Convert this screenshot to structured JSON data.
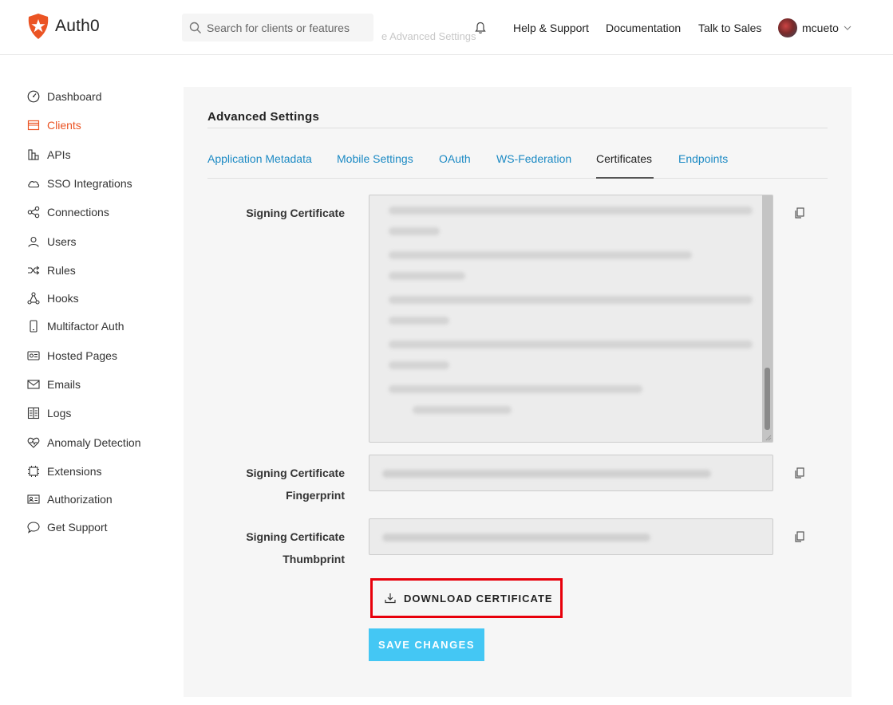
{
  "header": {
    "brand": "Auth0",
    "search_placeholder": "Search for clients or features",
    "ghost_text": "e Advanced Settings",
    "nav": [
      "Help & Support",
      "Documentation",
      "Talk to Sales"
    ],
    "username": "mcueto"
  },
  "sidebar": {
    "items": [
      {
        "label": "Dashboard",
        "icon": "dashboard-icon"
      },
      {
        "label": "Clients",
        "icon": "clients-icon",
        "active": true
      },
      {
        "label": "APIs",
        "icon": "apis-icon"
      },
      {
        "label": "SSO Integrations",
        "icon": "cloud-icon"
      },
      {
        "label": "Connections",
        "icon": "connections-icon"
      },
      {
        "label": "Users",
        "icon": "users-icon"
      },
      {
        "label": "Rules",
        "icon": "rules-icon"
      },
      {
        "label": "Hooks",
        "icon": "hooks-icon"
      },
      {
        "label": "Multifactor Auth",
        "icon": "phone-icon"
      },
      {
        "label": "Hosted Pages",
        "icon": "hosted-pages-icon"
      },
      {
        "label": "Emails",
        "icon": "email-icon"
      },
      {
        "label": "Logs",
        "icon": "logs-icon"
      },
      {
        "label": "Anomaly Detection",
        "icon": "heart-pulse-icon"
      },
      {
        "label": "Extensions",
        "icon": "extensions-icon"
      },
      {
        "label": "Authorization",
        "icon": "id-card-icon"
      },
      {
        "label": "Get Support",
        "icon": "chat-icon"
      }
    ]
  },
  "main": {
    "section_title": "Advanced Settings",
    "tabs": [
      {
        "label": "Application Metadata"
      },
      {
        "label": "Mobile Settings"
      },
      {
        "label": "OAuth"
      },
      {
        "label": "WS-Federation"
      },
      {
        "label": "Certificates",
        "active": true
      },
      {
        "label": "Endpoints"
      }
    ],
    "fields": {
      "signing_certificate": "Signing Certificate",
      "fingerprint_line1": "Signing Certificate",
      "fingerprint_line2": "Fingerprint",
      "thumbprint_line1": "Signing Certificate",
      "thumbprint_line2": "Thumbprint"
    },
    "download_label": "DOWNLOAD CERTIFICATE",
    "save_label": "SAVE CHANGES"
  },
  "colors": {
    "brand": "#eb5424",
    "link": "#1c8ac4",
    "save_button": "#44c7f4",
    "highlight_box": "#e8000b"
  }
}
